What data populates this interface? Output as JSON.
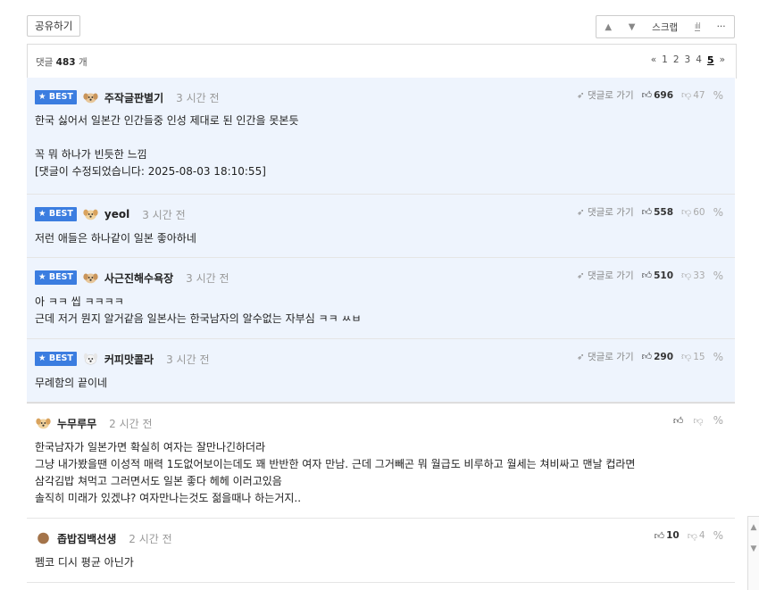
{
  "toolbar": {
    "share_label": "공유하기",
    "up_icon": "arrow-up-icon",
    "down_icon": "arrow-down-icon",
    "scrap_label": "스크랩",
    "chart_icon": "bar-chart-icon",
    "more_label": "···"
  },
  "header": {
    "count_prefix": "댓글",
    "count_value": "483",
    "count_suffix": "개",
    "pager": {
      "prev": "«",
      "pages": [
        "1",
        "2",
        "3",
        "4"
      ],
      "current": "5",
      "next": "»"
    }
  },
  "goto_label": "댓글로 가기",
  "best_label": "BEST",
  "comments": [
    {
      "best": true,
      "nick": "주작글판별기",
      "time": "3 시간 전",
      "up": "696",
      "down": "47",
      "lines": [
        "한국 싫어서 일본간 인간들중 인성 제대로 된 인간을 못본듯",
        "",
        "꼭 뭐 하나가 빈듯한 느낌",
        "[댓글이 수정되었습니다: 2025-08-03 18:10:55]"
      ]
    },
    {
      "best": true,
      "nick": "yeol",
      "time": "3 시간 전",
      "up": "558",
      "down": "60",
      "lines": [
        "저런 애들은 하나같이 일본 좋아하네"
      ]
    },
    {
      "best": true,
      "nick": "사근진해수욕장",
      "time": "3 시간 전",
      "up": "510",
      "down": "33",
      "lines": [
        "아 ㅋㅋ 씹 ㅋㅋㅋㅋ",
        "근데 저거 뭔지 알거같음 일본사는 한국남자의 알수없는 자부심 ㅋㅋ ㅆㅂ"
      ]
    },
    {
      "best": true,
      "nick": "커피맛콜라",
      "time": "3 시간 전",
      "up": "290",
      "down": "15",
      "lines": [
        "무례함의 끝이네"
      ]
    },
    {
      "best": false,
      "nick": "누무루무",
      "time": "2 시간 전",
      "up": "",
      "down": "",
      "lines": [
        "한국남자가 일본가면 확실히 여자는 잘만나긴하더라",
        "그냥 내가봤을땐 이성적 매력 1도없어보이는데도 꽤 반반한 여자 만남. 근데 그거빼곤 뭐 월급도 비루하고 월세는 쳐비싸고 맨날 컵라면",
        "삼각김밥 쳐먹고 그러면서도 일본 좋다 헤헤 이러고있음",
        "솔직히 미래가 있겠냐? 여자만나는것도 젊을때나 하는거지.."
      ]
    },
    {
      "best": false,
      "nick": "좁밥집백선생",
      "time": "2 시간 전",
      "up": "10",
      "down": "4",
      "lines": [
        "펨코 디시 평균 아닌가"
      ]
    }
  ],
  "colors": {
    "best_bg": "#eef4fd",
    "badge": "#3b7de0"
  }
}
